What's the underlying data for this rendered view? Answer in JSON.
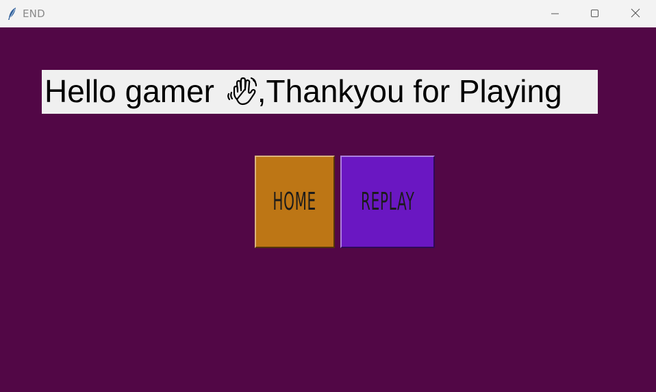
{
  "window": {
    "title": "END",
    "background": "#520746"
  },
  "titlebar": {
    "app_icon": "feather-icon",
    "controls": [
      "minimize-icon",
      "maximize-icon",
      "close-icon"
    ]
  },
  "greeting": {
    "text_before": "Hello gamer ",
    "emoji_icon": "waving-hand-icon",
    "text_after": ",Thankyou for Playing"
  },
  "buttons": {
    "home_label": "HOME",
    "home_color": "#bd7615",
    "replay_label": "REPLAY",
    "replay_color": "#6a17c2"
  }
}
